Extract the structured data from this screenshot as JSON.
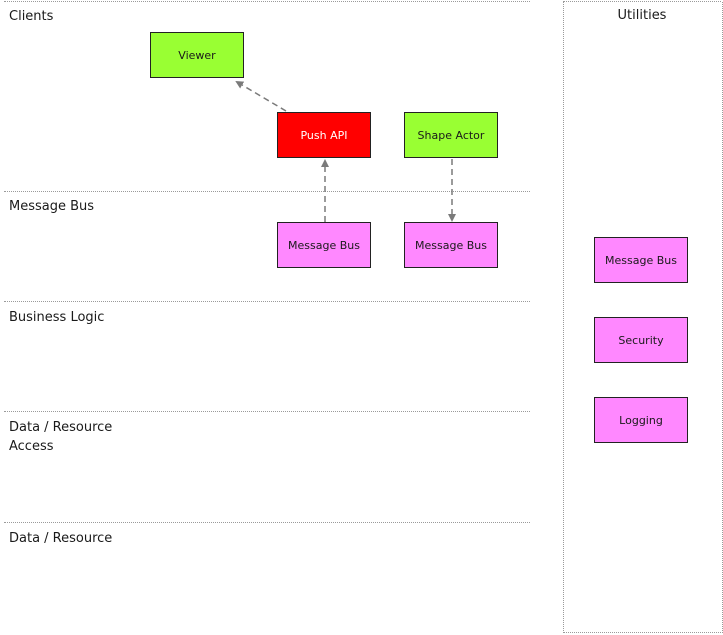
{
  "layers": [
    {
      "label": "Clients"
    },
    {
      "label": "Message Bus"
    },
    {
      "label": "Business Logic"
    },
    {
      "label": "Data / Resource\nAccess"
    },
    {
      "label": "Data / Resource"
    }
  ],
  "utilities": {
    "title": "Utilities",
    "boxes": [
      {
        "label": "Message Bus"
      },
      {
        "label": "Security"
      },
      {
        "label": "Logging"
      }
    ]
  },
  "nodes": {
    "viewer": {
      "label": "Viewer"
    },
    "push_api": {
      "label": "Push API"
    },
    "shape_actor": {
      "label": "Shape Actor"
    },
    "bus_left": {
      "label": "Message Bus"
    },
    "bus_right": {
      "label": "Message Bus"
    }
  },
  "colors": {
    "client_green": "#99ff33",
    "push_red": "#ff0000",
    "bus_pink": "#ff88ff",
    "arrow_gray": "#7a7a7a"
  }
}
